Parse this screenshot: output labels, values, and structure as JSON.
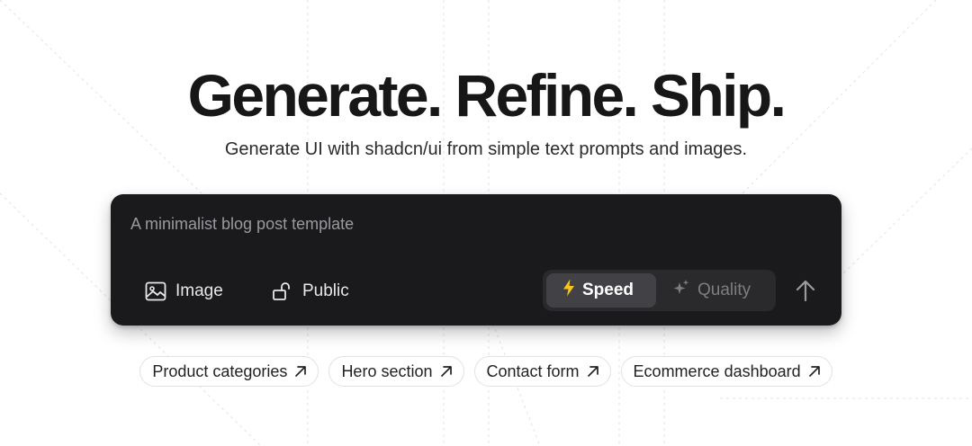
{
  "hero": {
    "title": "Generate. Refine. Ship.",
    "subtitle": "Generate UI with shadcn/ui from simple text prompts and images."
  },
  "prompt": {
    "placeholder": "A minimalist blog post template",
    "value": ""
  },
  "toolbar": {
    "image_label": "Image",
    "image_icon": "image-icon",
    "visibility_label": "Public",
    "visibility_icon": "unlock-icon",
    "modes": [
      {
        "label": "Speed",
        "icon": "lightning-icon",
        "selected": true
      },
      {
        "label": "Quality",
        "icon": "sparkles-icon",
        "selected": false
      }
    ],
    "send_icon": "arrow-up-icon"
  },
  "suggestions": [
    {
      "label": "Product categories",
      "icon": "arrow-up-right-icon"
    },
    {
      "label": "Hero section",
      "icon": "arrow-up-right-icon"
    },
    {
      "label": "Contact form",
      "icon": "arrow-up-right-icon"
    },
    {
      "label": "Ecommerce dashboard",
      "icon": "arrow-up-right-icon"
    }
  ],
  "colors": {
    "background": "#ffffff",
    "prompt_box": "#1a1a1c",
    "toggle_track": "#2a2a2d",
    "toggle_selected": "#424246",
    "speed_icon": "#f5c518",
    "grid_lines": "#e6e6e6"
  }
}
